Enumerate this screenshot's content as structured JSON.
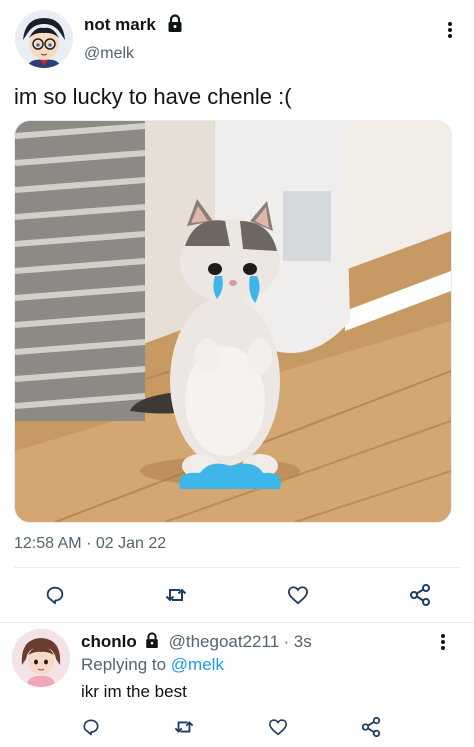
{
  "main_tweet": {
    "display_name": "not mark",
    "handle": "@melk",
    "text": "im so lucky to have chenle :(",
    "timestamp": "12:58 AM",
    "separator": "·",
    "date": "02 Jan 22",
    "media_icon": "crying-cat-photo",
    "actions": [
      "reply-icon",
      "retweet-icon",
      "like-icon",
      "share-icon"
    ],
    "more_icon": "more-vertical-icon"
  },
  "reply_tweet": {
    "display_name": "chonlo",
    "handle": "@thegoat2211",
    "separator": "·",
    "time_ago": "3s",
    "replying_prefix": "Replying to",
    "replying_handle": "@melk",
    "text": "ikr im the best",
    "actions": [
      "reply-icon",
      "retweet-icon",
      "like-icon",
      "share-icon"
    ],
    "more_icon": "more-vertical-icon"
  },
  "colors": {
    "text": "#0f1419",
    "muted": "#536471",
    "link": "#1d9bf0",
    "divider": "#e6ecf0",
    "tear": "#3fb6ea"
  }
}
